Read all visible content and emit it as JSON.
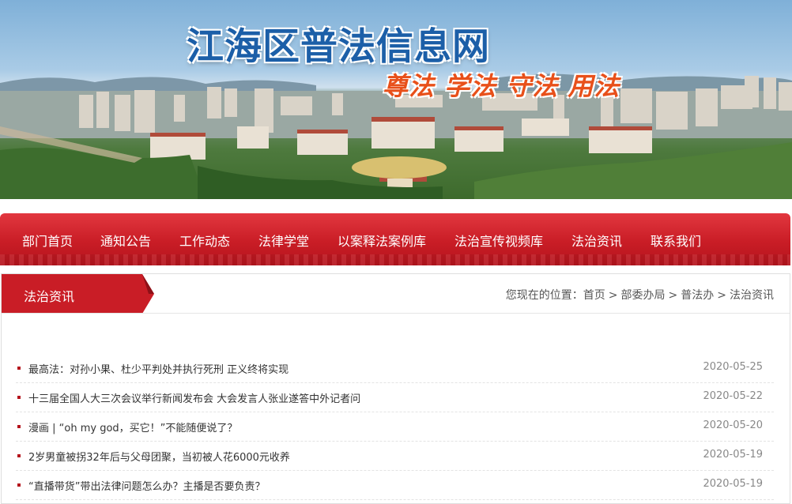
{
  "header": {
    "site_title": "江海区普法信息网",
    "slogan": "尊法 学法 守法 用法"
  },
  "nav": {
    "items": [
      {
        "label": "部门首页"
      },
      {
        "label": "通知公告"
      },
      {
        "label": "工作动态"
      },
      {
        "label": "法律学堂"
      },
      {
        "label": "以案释法案例库"
      },
      {
        "label": "法治宣传视频库"
      },
      {
        "label": "法治资讯"
      },
      {
        "label": "联系我们"
      }
    ]
  },
  "section": {
    "title": "法治资讯",
    "breadcrumb": {
      "prefix": "您现在的位置：",
      "items": [
        "首页",
        "部委办局",
        "普法办",
        "法治资讯"
      ],
      "separator": ">"
    }
  },
  "news": [
    {
      "title": "最高法：对孙小果、杜少平判处并执行死刑 正义终将实现",
      "date": "2020-05-25"
    },
    {
      "title": "十三届全国人大三次会议举行新闻发布会 大会发言人张业遂答中外记者问",
      "date": "2020-05-22"
    },
    {
      "title": "漫画 | “oh my god，买它！”不能随便说了？",
      "date": "2020-05-20"
    },
    {
      "title": "2岁男童被拐32年后与父母团聚，当初被人花6000元收养",
      "date": "2020-05-19"
    },
    {
      "title": "“直播带货”带出法律问题怎么办？主播是否要负责？",
      "date": "2020-05-19"
    }
  ],
  "colors": {
    "nav_red": "#c91d26",
    "title_blue": "#1c5fa8",
    "slogan_orange": "#e8501a"
  }
}
